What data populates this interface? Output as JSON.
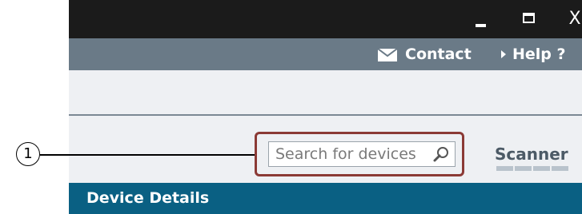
{
  "window_controls": {
    "minimize_icon": "minimize-icon",
    "maximize_icon": "maximize-icon",
    "close_label": "X"
  },
  "linkbar": {
    "contact_label": "Contact",
    "help_label": "Help ?"
  },
  "search": {
    "placeholder": "Search for devices"
  },
  "scanner": {
    "label": "Scanner"
  },
  "device_details": {
    "title": "Device Details"
  },
  "callout": {
    "number": "1"
  },
  "colors": {
    "titlebar": "#1b1b1b",
    "linkbar": "#6a7a87",
    "toolbar": "#eef0f3",
    "callout_border": "#8b3a35",
    "device_details": "#0a6083"
  }
}
